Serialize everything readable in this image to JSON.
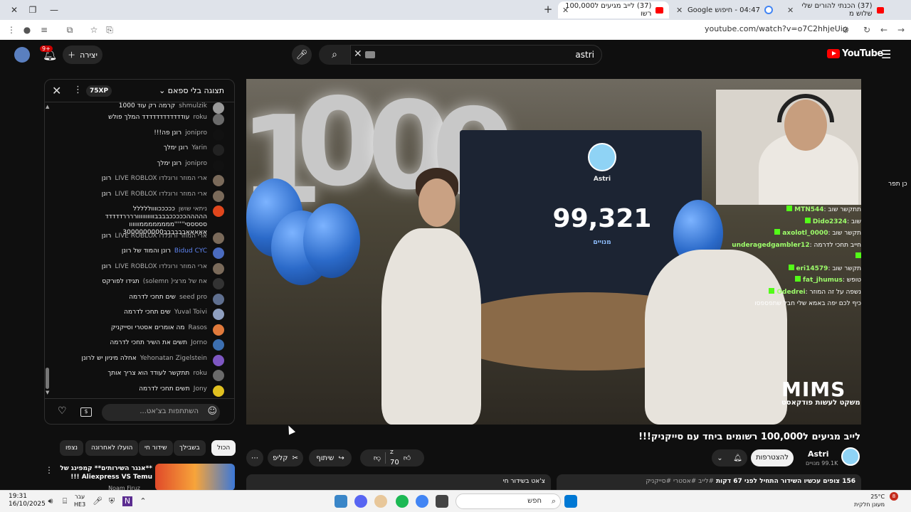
{
  "browser": {
    "tabs": [
      {
        "title": "(37) לייב מגיעים ל100,000 רשו",
        "active": true
      },
      {
        "title": "04:47 - חיפוש Google",
        "active": false
      },
      {
        "title": "(37) הכנתי להורים שלי שלוש מ",
        "active": false
      }
    ],
    "url": "youtube.com/watch?v=o7C2hhjeUio"
  },
  "yt_header": {
    "create_label": "יצירה",
    "notif_count": "9+",
    "search_value": "astri",
    "logo_text": "YouTube"
  },
  "chat": {
    "mode_label": "תצוגה בלי ספאם",
    "xp_label": "75XP",
    "input_placeholder": "השתתפות בצ'אט...",
    "messages": [
      {
        "author": "shmulzik",
        "text": "קרמה רק עוד 1000",
        "mod": false,
        "avatar_color": "#9a9a9a"
      },
      {
        "author": "roku",
        "text": "עודדדדדדדדדדדד המלך פולש",
        "mod": false,
        "avatar_color": "#6a6a6a"
      },
      {
        "author": "jonipro",
        "text": "רונן פה!!!",
        "mod": false,
        "avatar_color": "#111111"
      },
      {
        "author": "Yarin",
        "text": "רונן ימלך",
        "mod": false,
        "avatar_color": "#222222"
      },
      {
        "author": "jonipro",
        "text": "רונן ימלך",
        "mod": false,
        "avatar_color": "#111111"
      },
      {
        "author": "ארי המוזר ורונלדו LIVE ROBLOX",
        "text": "רונן",
        "mod": false,
        "avatar_color": "#7a6a5a"
      },
      {
        "author": "ארי המוזר ורונלדו LIVE ROBLOX",
        "text": "רונן",
        "mod": false,
        "avatar_color": "#7a6a5a"
      },
      {
        "author": "ניתאי שושן",
        "text": "כככככווווללללל הההההכככככבבבבווווווווווררררדדדדד סססססי''''''ממממממממוווווו אאאאאבבבבבב3000000000",
        "mod": false,
        "avatar_color": "#e0461c"
      },
      {
        "author": "ארי המוזר ורונלדו LIVE ROBLOX",
        "text": "רונן",
        "mod": false,
        "avatar_color": "#7a6a5a"
      },
      {
        "author": "Bidud CYC",
        "text": "רונן והמוד של רונן",
        "mod": true,
        "avatar_color": "#4a6bbf"
      },
      {
        "author": "ארי המוזר ורונלדו LIVE ROBLOX",
        "text": "רונן",
        "mod": false,
        "avatar_color": "#7a6a5a"
      },
      {
        "author": "אח של מרצי( solemn)",
        "text": "תגידו לפורקס",
        "mod": false,
        "avatar_color": "#333333"
      },
      {
        "author": "seed pro",
        "text": "שים תחכי לדרמה",
        "mod": false,
        "avatar_color": "#5f6f8f"
      },
      {
        "author": "Yuval Toivi",
        "text": "שים תחכי לדרמה",
        "mod": false,
        "avatar_color": "#8f9fbf"
      },
      {
        "author": "Rasos",
        "text": "מה אומרים אסטרי וסייקניק",
        "mod": false,
        "avatar_color": "#e07a3c"
      },
      {
        "author": "Jorno",
        "text": "תשים את השיר תחכי לדרמה",
        "mod": false,
        "avatar_color": "#3c6fb0"
      },
      {
        "author": "Yehonatan Zigelstein",
        "text": "אחלה מיניון יש לרונן",
        "mod": false,
        "avatar_color": "#7e57c2"
      },
      {
        "author": "roku",
        "text": "תתקשר לעודד הוא צריך אותך",
        "mod": false,
        "avatar_color": "#6a6a6a"
      },
      {
        "author": "Jony",
        "text": "תשים תחכי לדרמה",
        "mod": false,
        "avatar_color": "#e0c020"
      }
    ]
  },
  "stream_overlay": {
    "tv_name": "Astri",
    "tv_count": "99,321",
    "tv_sub": "מנויים",
    "brand": "MIMS",
    "brand_sub": "משקט לעשות פודקאסט",
    "side_text": "כן תפר",
    "overlay_chat": [
      {
        "name": "MTN544",
        "text": "תתקשר שוב :"
      },
      {
        "name": "Dido2324",
        "text": "שוב :"
      },
      {
        "name": "axolotl_0000",
        "text": "תקשר שוב :"
      },
      {
        "name": "underagedgambler12",
        "text": "חייב תחכי לדרמה :"
      },
      {
        "name": "eri14579",
        "text": "תקשר שוב :"
      },
      {
        "name": "fat_jhumus",
        "text": "טופש :"
      },
      {
        "name": "Odedrei",
        "text": "נשפה על זה המוזר :"
      },
      {
        "name": "",
        "text": "כיף לכם יפה באמא שלי חבל שתפספסו"
      }
    ]
  },
  "video": {
    "title": "לייב מגיעים ל100,000 רשומים ביחד עם סייקניק!!!",
    "channel": "Astri",
    "subs": "99.1K מנויים",
    "subscribe_label": "להצטרפות",
    "likes": "70",
    "likes_sup": "Z",
    "share_label": "שיתוף",
    "clip_label": "קליפ",
    "description_views": "156 צופים עכשיו השידור התחיל לפני 67 דקות",
    "description_tags": "#לייב #אסטרי #סייקניק",
    "chat_replay_label": "צ'אט בשידור חי"
  },
  "filters": {
    "chips": [
      "הכול",
      "בשבילך",
      "שידור חי",
      "הועלו לאחרונה",
      "נצפו"
    ]
  },
  "recommended": {
    "title": "**אנגר השירותים** קמפינג של Aliexpress VS Temu !!!",
    "channel": "Noam Firuz"
  },
  "taskbar": {
    "time": "19:31",
    "date": "16/10/2025",
    "lang_top": "עבר",
    "lang_bottom": "HE3",
    "search_placeholder": "חפש",
    "weather_temp": "25°C",
    "weather_desc": "מעונן חלקית",
    "notif_count": "8"
  }
}
